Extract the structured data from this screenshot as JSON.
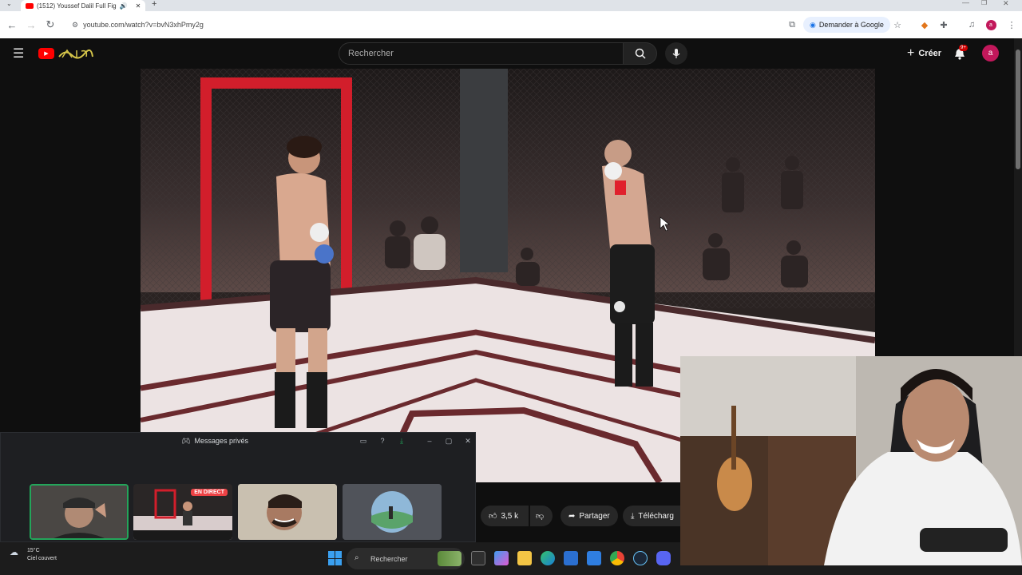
{
  "browser": {
    "tab_title": "(1512) Youssef Dalil Full Fig",
    "url": "youtube.com/watch?v=bvN3xhPmy2g",
    "ask_google": "Demander à Google",
    "profile_initial": "a"
  },
  "youtube": {
    "search_placeholder": "Rechercher",
    "create_label": "Créer",
    "notification_badge": "9+",
    "avatar_initial": "a",
    "brand_color": "#ff0000"
  },
  "actions": {
    "like_count": "3,5 k",
    "share_label": "Partager",
    "download_label": "Télécharg"
  },
  "discord": {
    "title": "Messages privés",
    "live_badge": "EN DIRECT"
  },
  "taskbar": {
    "temperature": "15°C",
    "weather": "Ciel couvert",
    "search_label": "Rechercher"
  }
}
